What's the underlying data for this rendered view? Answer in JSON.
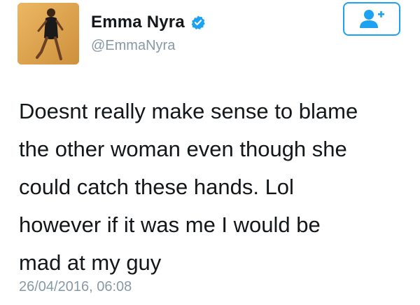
{
  "user": {
    "name": "Emma Nyra",
    "handle": "@EmmaNyra",
    "verified": true,
    "avatar_icon": "profile-photo"
  },
  "follow_button": {
    "icon": "follow-user-plus-icon",
    "accent_color": "#1da1f2"
  },
  "tweet": {
    "text": "Doesnt really make sense to blame\nthe other woman even though she\ncould catch these hands. Lol\nhowever if it was me I would be\nmad at my guy",
    "timestamp": "26/04/2016, 06:08"
  },
  "colors": {
    "text": "#14171a",
    "secondary": "#8899a6",
    "accent": "#1da1f2"
  }
}
